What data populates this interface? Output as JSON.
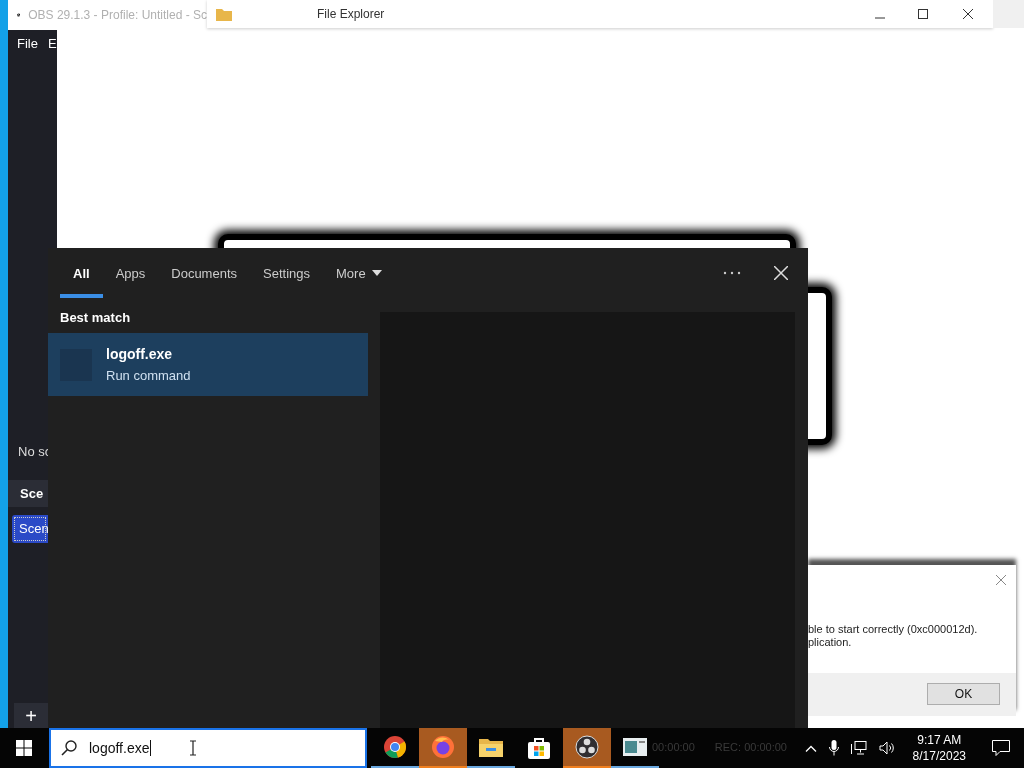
{
  "obs_window": {
    "title": "OBS 29.1.3 - Profile: Untitled - Sc",
    "menu": [
      "File",
      "E"
    ],
    "sources_hint": "No sc",
    "scenes_header": "Sce",
    "scenes": [
      {
        "label": "Scen",
        "selected": true
      }
    ],
    "add_button": "+"
  },
  "explorer_window": {
    "title": "File Explorer"
  },
  "error_dialog": {
    "lines": [
      "ble to start correctly (0xc000012d).",
      "plication."
    ],
    "ok": "OK"
  },
  "search_panel": {
    "tabs": [
      {
        "label": "All",
        "selected": true
      },
      {
        "label": "Apps",
        "selected": false
      },
      {
        "label": "Documents",
        "selected": false
      },
      {
        "label": "Settings",
        "selected": false
      },
      {
        "label": "More",
        "selected": false
      }
    ],
    "section": "Best match",
    "results": [
      {
        "title": "logoff.exe",
        "subtitle": "Run command",
        "selected": true
      }
    ]
  },
  "taskbar": {
    "search_value": "logoff.exe",
    "apps": [
      {
        "kind": "chrome",
        "active": false,
        "running": true
      },
      {
        "kind": "firefox",
        "active": true,
        "running": true
      },
      {
        "kind": "folder",
        "active": false,
        "running": true
      },
      {
        "kind": "store",
        "active": false,
        "running": false
      },
      {
        "kind": "obs",
        "active": true,
        "running": true
      },
      {
        "kind": "window",
        "active": false,
        "running": true
      }
    ],
    "faded_status": [
      "00:00:00",
      "REC: 00:00:00"
    ],
    "time": "9:17 AM",
    "date": "8/17/2023"
  }
}
